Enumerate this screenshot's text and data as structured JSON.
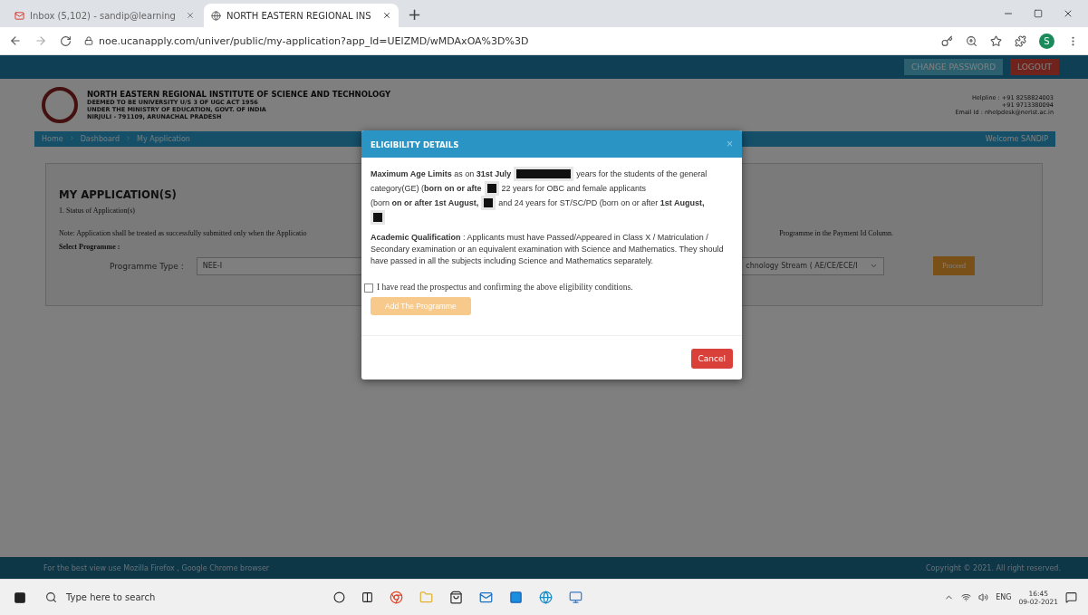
{
  "browser": {
    "tabs": [
      {
        "label": "Inbox (5,102) - sandip@learning",
        "kind": "mail",
        "selected": false
      },
      {
        "label": "NORTH EASTERN REGIONAL INS",
        "kind": "globe",
        "selected": true
      }
    ],
    "new_tab": "+",
    "url": "noe.ucanapply.com/univer/public/my-application?app_Id=UElZMD/wMDAxOA%3D%3D",
    "profile": "S"
  },
  "site": {
    "top_buttons": [
      {
        "label": "CHANGE PASSWORD",
        "kind": "info"
      },
      {
        "label": "LOGOUT",
        "kind": "danger"
      }
    ],
    "institute": {
      "name": "NORTH EASTERN REGIONAL INSTITUTE OF SCIENCE AND TECHNOLOGY",
      "lines": [
        "DEEMED TO BE UNIVERSITY U/S 3 OF UGC ACT 1956",
        "UNDER THE MINISTRY OF EDUCATION, GOVT. OF INDIA",
        "NIRJULI - 791109, ARUNACHAL PRADESH"
      ]
    },
    "contact": [
      "Helpline : +91 8258824003",
      "+91 9713380094",
      "Email Id : nhelpdesk@nerist.ac.in"
    ],
    "breadcrumb": [
      "Home",
      "Dashboard",
      "My Application"
    ],
    "welcome": "Welcome SANDIP",
    "card": {
      "title": "MY APPLICATION(S)",
      "status_heading": "1. Status of Application(s)",
      "note_left": "Note: Application shall be treated as successfully submitted only when the Applicatio",
      "note_right": "Programme in the Payment Id Column.",
      "select_label": "Select Programme :",
      "type_label": "Programme Type :",
      "type_value": "NEE-I",
      "stream_value": "chnology Stream ( AE/CE/ECE/I",
      "proceed": "Proceed"
    },
    "footer_left": "For the best view use Mozilla Firefox , Google Chrome browser",
    "footer_right": "Copyright © 2021. All right reserved."
  },
  "modal": {
    "title": "ELIGIBILITY DETAILS",
    "close": "×",
    "age_lines": [
      [
        {
          "kind": "text",
          "text": "**Maximum Age Limits** as on **31st July**"
        },
        {
          "kind": "bar"
        },
        {
          "kind": "text",
          "text": "years for the students of the general"
        }
      ],
      [
        {
          "kind": "text",
          "text": "category(GE) (**born on or afte**"
        },
        {
          "kind": "square"
        },
        {
          "kind": "text",
          "text": "22 years for OBC and female applicants"
        }
      ],
      [
        {
          "kind": "text",
          "text": "(born **on or after 1st August,**"
        },
        {
          "kind": "square"
        },
        {
          "kind": "text",
          "text": "and 24 years for ST/SC/PD (born on or after **1st August,**"
        }
      ],
      [
        {
          "kind": "square"
        }
      ]
    ],
    "qualification": "**Academic Qualification** :  Applicants must have Passed/Appeared in Class X / Matriculation / Secondary examination or an equivalent examination with Science and Mathematics. They should have passed in all the subjects including Science and Mathematics separately.",
    "confirm": {
      "label": "I have read the prospectus and confirming the above eligibility conditions.",
      "checked": false
    },
    "add_button": {
      "label": "Add The Programme",
      "disabled": true
    },
    "cancel": "Cancel"
  },
  "taskbar": {
    "search_placeholder": "Type here to search",
    "apps": [
      {
        "kind": "circle"
      },
      {
        "kind": "taskview"
      },
      {
        "kind": "chrome"
      },
      {
        "kind": "folder"
      },
      {
        "kind": "store"
      },
      {
        "kind": "mail"
      },
      {
        "kind": "tile"
      },
      {
        "kind": "edge"
      },
      {
        "kind": "app"
      }
    ],
    "lang": "ENG",
    "time": "16:45",
    "date": "09-02-2021"
  }
}
